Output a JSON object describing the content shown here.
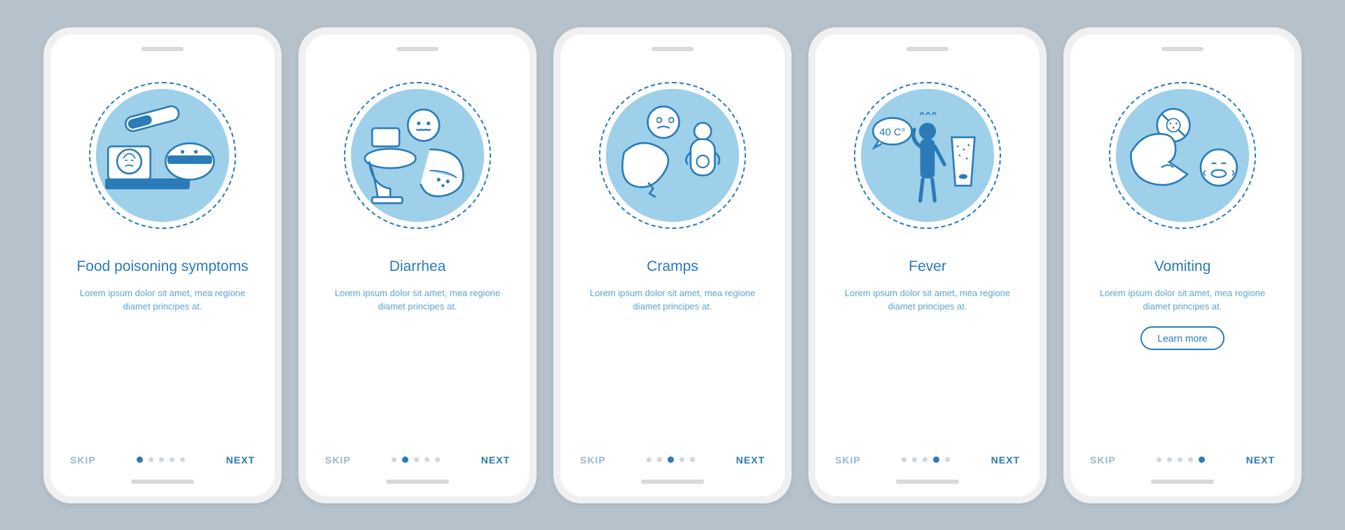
{
  "nav": {
    "skip": "SKIP",
    "next": "NEXT",
    "learn_more": "Learn more"
  },
  "screens": [
    {
      "title": "Food poisoning symptoms",
      "desc": "Lorem ipsum dolor sit amet, mea regione diamet principes at.",
      "icon": "sick-person-bed-icon",
      "active_dot": 0
    },
    {
      "title": "Diarrhea",
      "desc": "Lorem ipsum dolor sit amet, mea regione diamet principes at.",
      "icon": "toilet-icon",
      "active_dot": 1
    },
    {
      "title": "Cramps",
      "desc": "Lorem ipsum dolor sit amet, mea regione diamet principes at.",
      "icon": "stomach-pain-icon",
      "active_dot": 2
    },
    {
      "title": "Fever",
      "desc": "Lorem ipsum dolor sit amet, mea regione diamet principes at.",
      "icon": "fever-temperature-icon",
      "fever_label": "40 C°",
      "active_dot": 3
    },
    {
      "title": "Vomiting",
      "desc": "Lorem ipsum dolor sit amet, mea regione diamet principes at.",
      "icon": "nausea-icon",
      "active_dot": 4,
      "has_learn_more": true
    }
  ]
}
